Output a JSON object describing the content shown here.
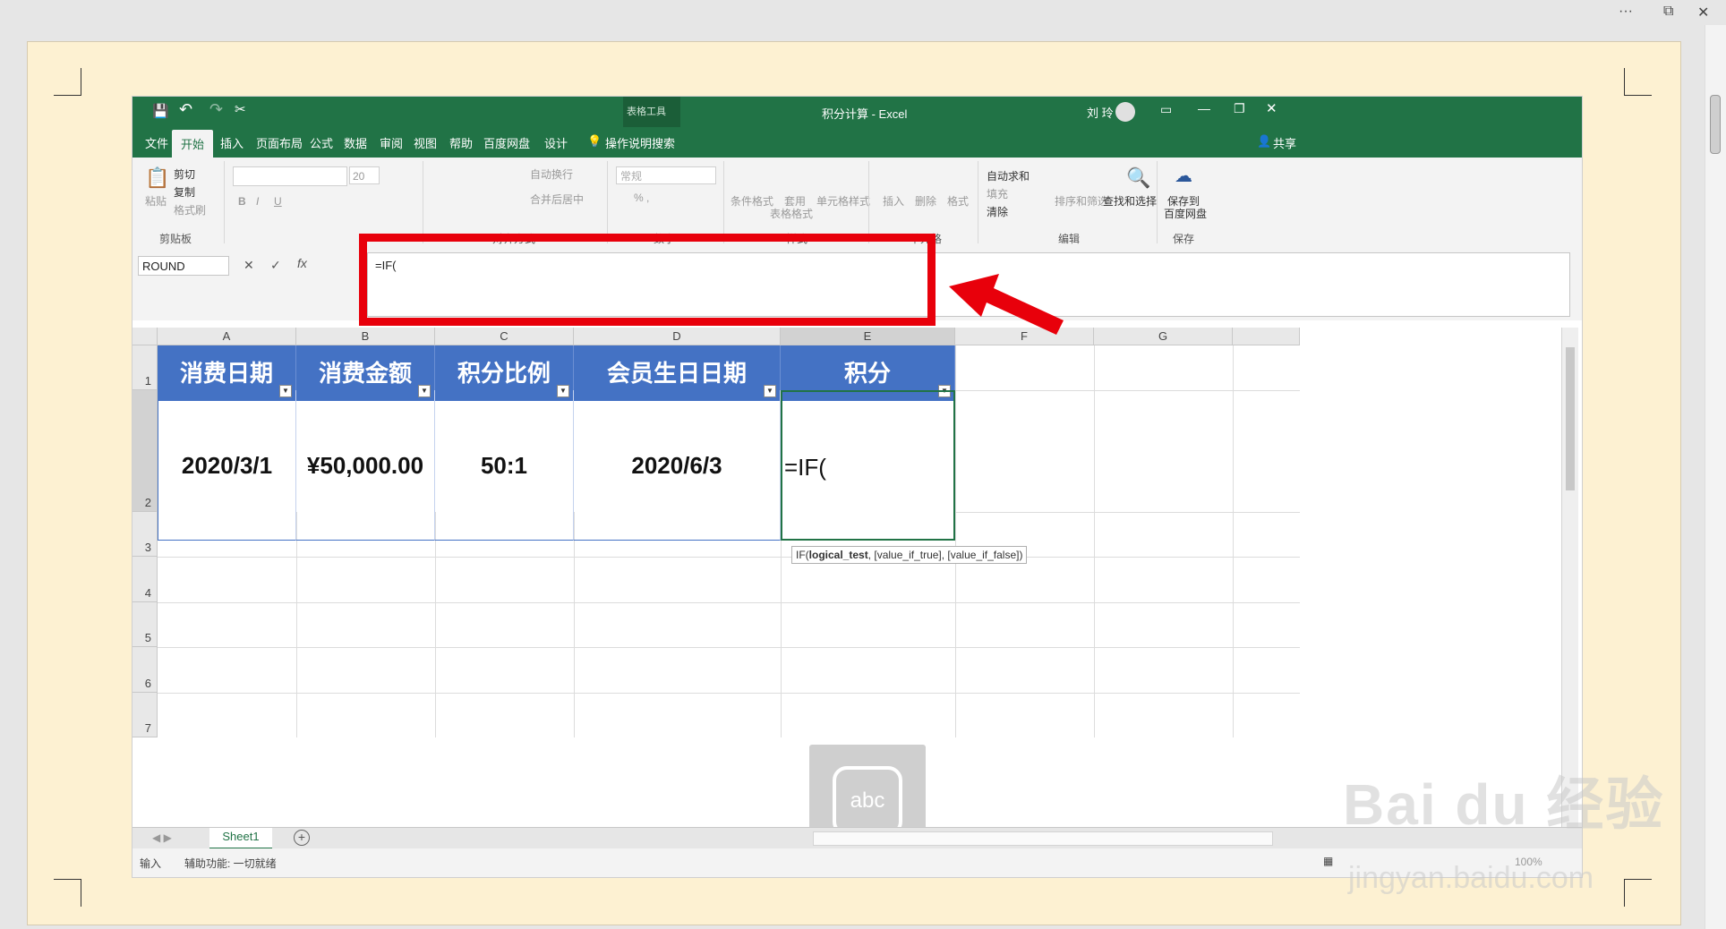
{
  "window_controls": {
    "more": "···",
    "restore": "⧉",
    "close": "✕"
  },
  "excel": {
    "title": "积分计算 - Excel",
    "context_tools": "表格工具",
    "user": "刘 玲",
    "qat": {
      "save": "💾",
      "undo": "↶",
      "redo": "↷",
      "cut": "✂"
    },
    "tabs": [
      "文件",
      "开始",
      "插入",
      "页面布局",
      "公式",
      "数据",
      "审阅",
      "视图",
      "帮助",
      "百度网盘",
      "设计"
    ],
    "tell_me": "操作说明搜索",
    "share": "共享",
    "ribbon": {
      "clipboard": {
        "paste": "粘贴",
        "cut": "剪切",
        "copy": "复制",
        "format_painter": "格式刷",
        "group": "剪贴板"
      },
      "font": {
        "size": "20",
        "bold": "B",
        "italic": "I",
        "underline": "U"
      },
      "alignment": {
        "wrap": "自动换行",
        "merge": "合并后居中",
        "group": "对齐方式"
      },
      "number": {
        "format": "常规",
        "group": "数字"
      },
      "styles": {
        "conditional": "条件格式",
        "table": "套用",
        "table2": "表格格式",
        "cell_styles": "单元格样式",
        "group": "样式"
      },
      "cells": {
        "insert": "插入",
        "delete": "删除",
        "format": "格式",
        "group": "单元格"
      },
      "editing": {
        "autosum": "自动求和",
        "fill": "填充",
        "clear": "清除",
        "sort": "排序和筛选",
        "find": "查找和选择",
        "group": "编辑"
      },
      "save": {
        "label1": "保存到",
        "label2": "百度网盘",
        "group": "保存"
      }
    },
    "name_box": "ROUND",
    "formula": "=IF(",
    "columns": [
      "A",
      "B",
      "C",
      "D",
      "E",
      "F",
      "G"
    ],
    "rows": [
      "1",
      "2",
      "3",
      "4",
      "5",
      "6",
      "7"
    ],
    "headers": [
      "消费日期",
      "消费金额",
      "积分比例",
      "会员生日日期",
      "积分"
    ],
    "values": [
      "2020/3/1",
      "¥50,000.00",
      "50:1",
      "2020/6/3",
      "=IF("
    ],
    "tooltip_fn": "IF(",
    "tooltip_arg1": "logical_test",
    "tooltip_rest": ", [value_if_true], [value_if_false])",
    "ime_label": "abc",
    "sheet_tab": "Sheet1",
    "status_mode": "输入",
    "accessibility": "辅助功能: 一切就绪",
    "zoom": "100%"
  },
  "watermark": {
    "brand": "Bai du 经验",
    "url": "jingyan.baidu.com"
  },
  "accent_colors": {
    "excel_green": "#217346",
    "header_blue": "#4472c4",
    "highlight_red": "#e8000b"
  }
}
